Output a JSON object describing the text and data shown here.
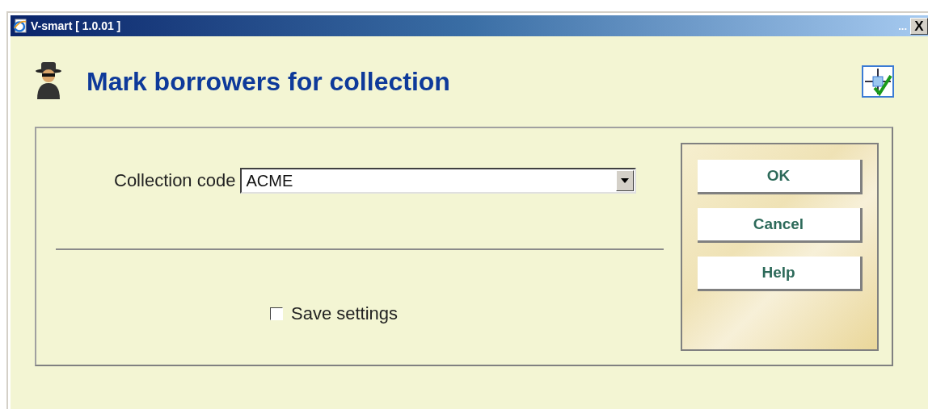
{
  "window": {
    "title": "V-smart [ 1.0.01 ]",
    "overflow_label": "...",
    "close_label": "X"
  },
  "heading": "Mark borrowers for collection",
  "form": {
    "collection_code": {
      "label": "Collection code",
      "value": "ACME"
    },
    "save_settings": {
      "label": "Save settings",
      "checked": false
    }
  },
  "buttons": [
    {
      "label": "OK"
    },
    {
      "label": "Cancel"
    },
    {
      "label": "Help"
    }
  ]
}
